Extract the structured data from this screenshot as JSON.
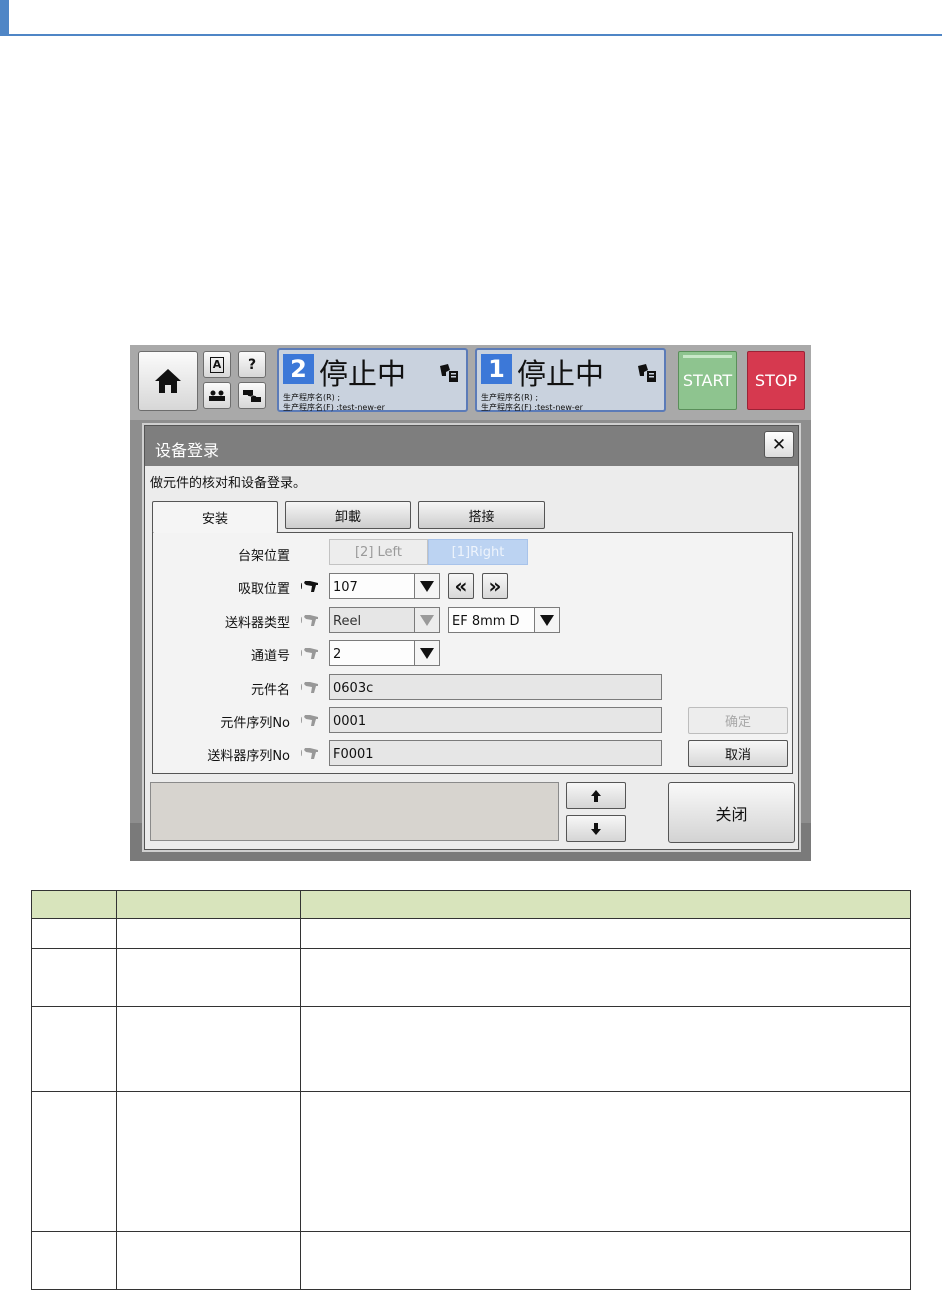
{
  "machine": {
    "icons": [
      "home-icon",
      "language-icon",
      "help-icon",
      "users-icon",
      "network-icon"
    ],
    "a_label": "A",
    "help_label": "?",
    "lanes": [
      {
        "num": "2",
        "state": "停止中",
        "prog_r": "生产程序名(R) ;",
        "prog_f": "生产程序名(F) :test-new-er"
      },
      {
        "num": "1",
        "state": "停止中",
        "prog_r": "生产程序名(R) ;",
        "prog_f": "生产程序名(F) :test-new-er"
      }
    ],
    "start_label": "START",
    "stop_label": "STOP",
    "colors": {
      "start": "#8ec48f",
      "stop": "#d6394f",
      "lane": "#3c78d8"
    }
  },
  "dialog": {
    "title": "设备登录",
    "close_glyph": "✕",
    "description": "做元件的核对和设备登录。",
    "tabs": [
      "安装",
      "卸載",
      "搭接"
    ],
    "fields": {
      "rack_label": "台架位置",
      "rack_options": [
        "[2] Left",
        "[1]Right"
      ],
      "pick_label": "吸取位置",
      "pick_value": "107",
      "feeder_type_label": "送料器类型",
      "feeder_type_value": "Reel",
      "feeder_model_value": "EF 8mm D",
      "lane_label": "通道号",
      "lane_value": "2",
      "part_name_label": "元件名",
      "part_name_value": "0603c",
      "part_serial_label": "元件序列No",
      "part_serial_value": "0001",
      "feeder_serial_label": "送料器序列No",
      "feeder_serial_value": "F0001"
    },
    "confirm_label": "确定",
    "cancel_label": "取消",
    "close_label": "关闭",
    "prev_glyph": "«",
    "next_glyph": "»"
  }
}
